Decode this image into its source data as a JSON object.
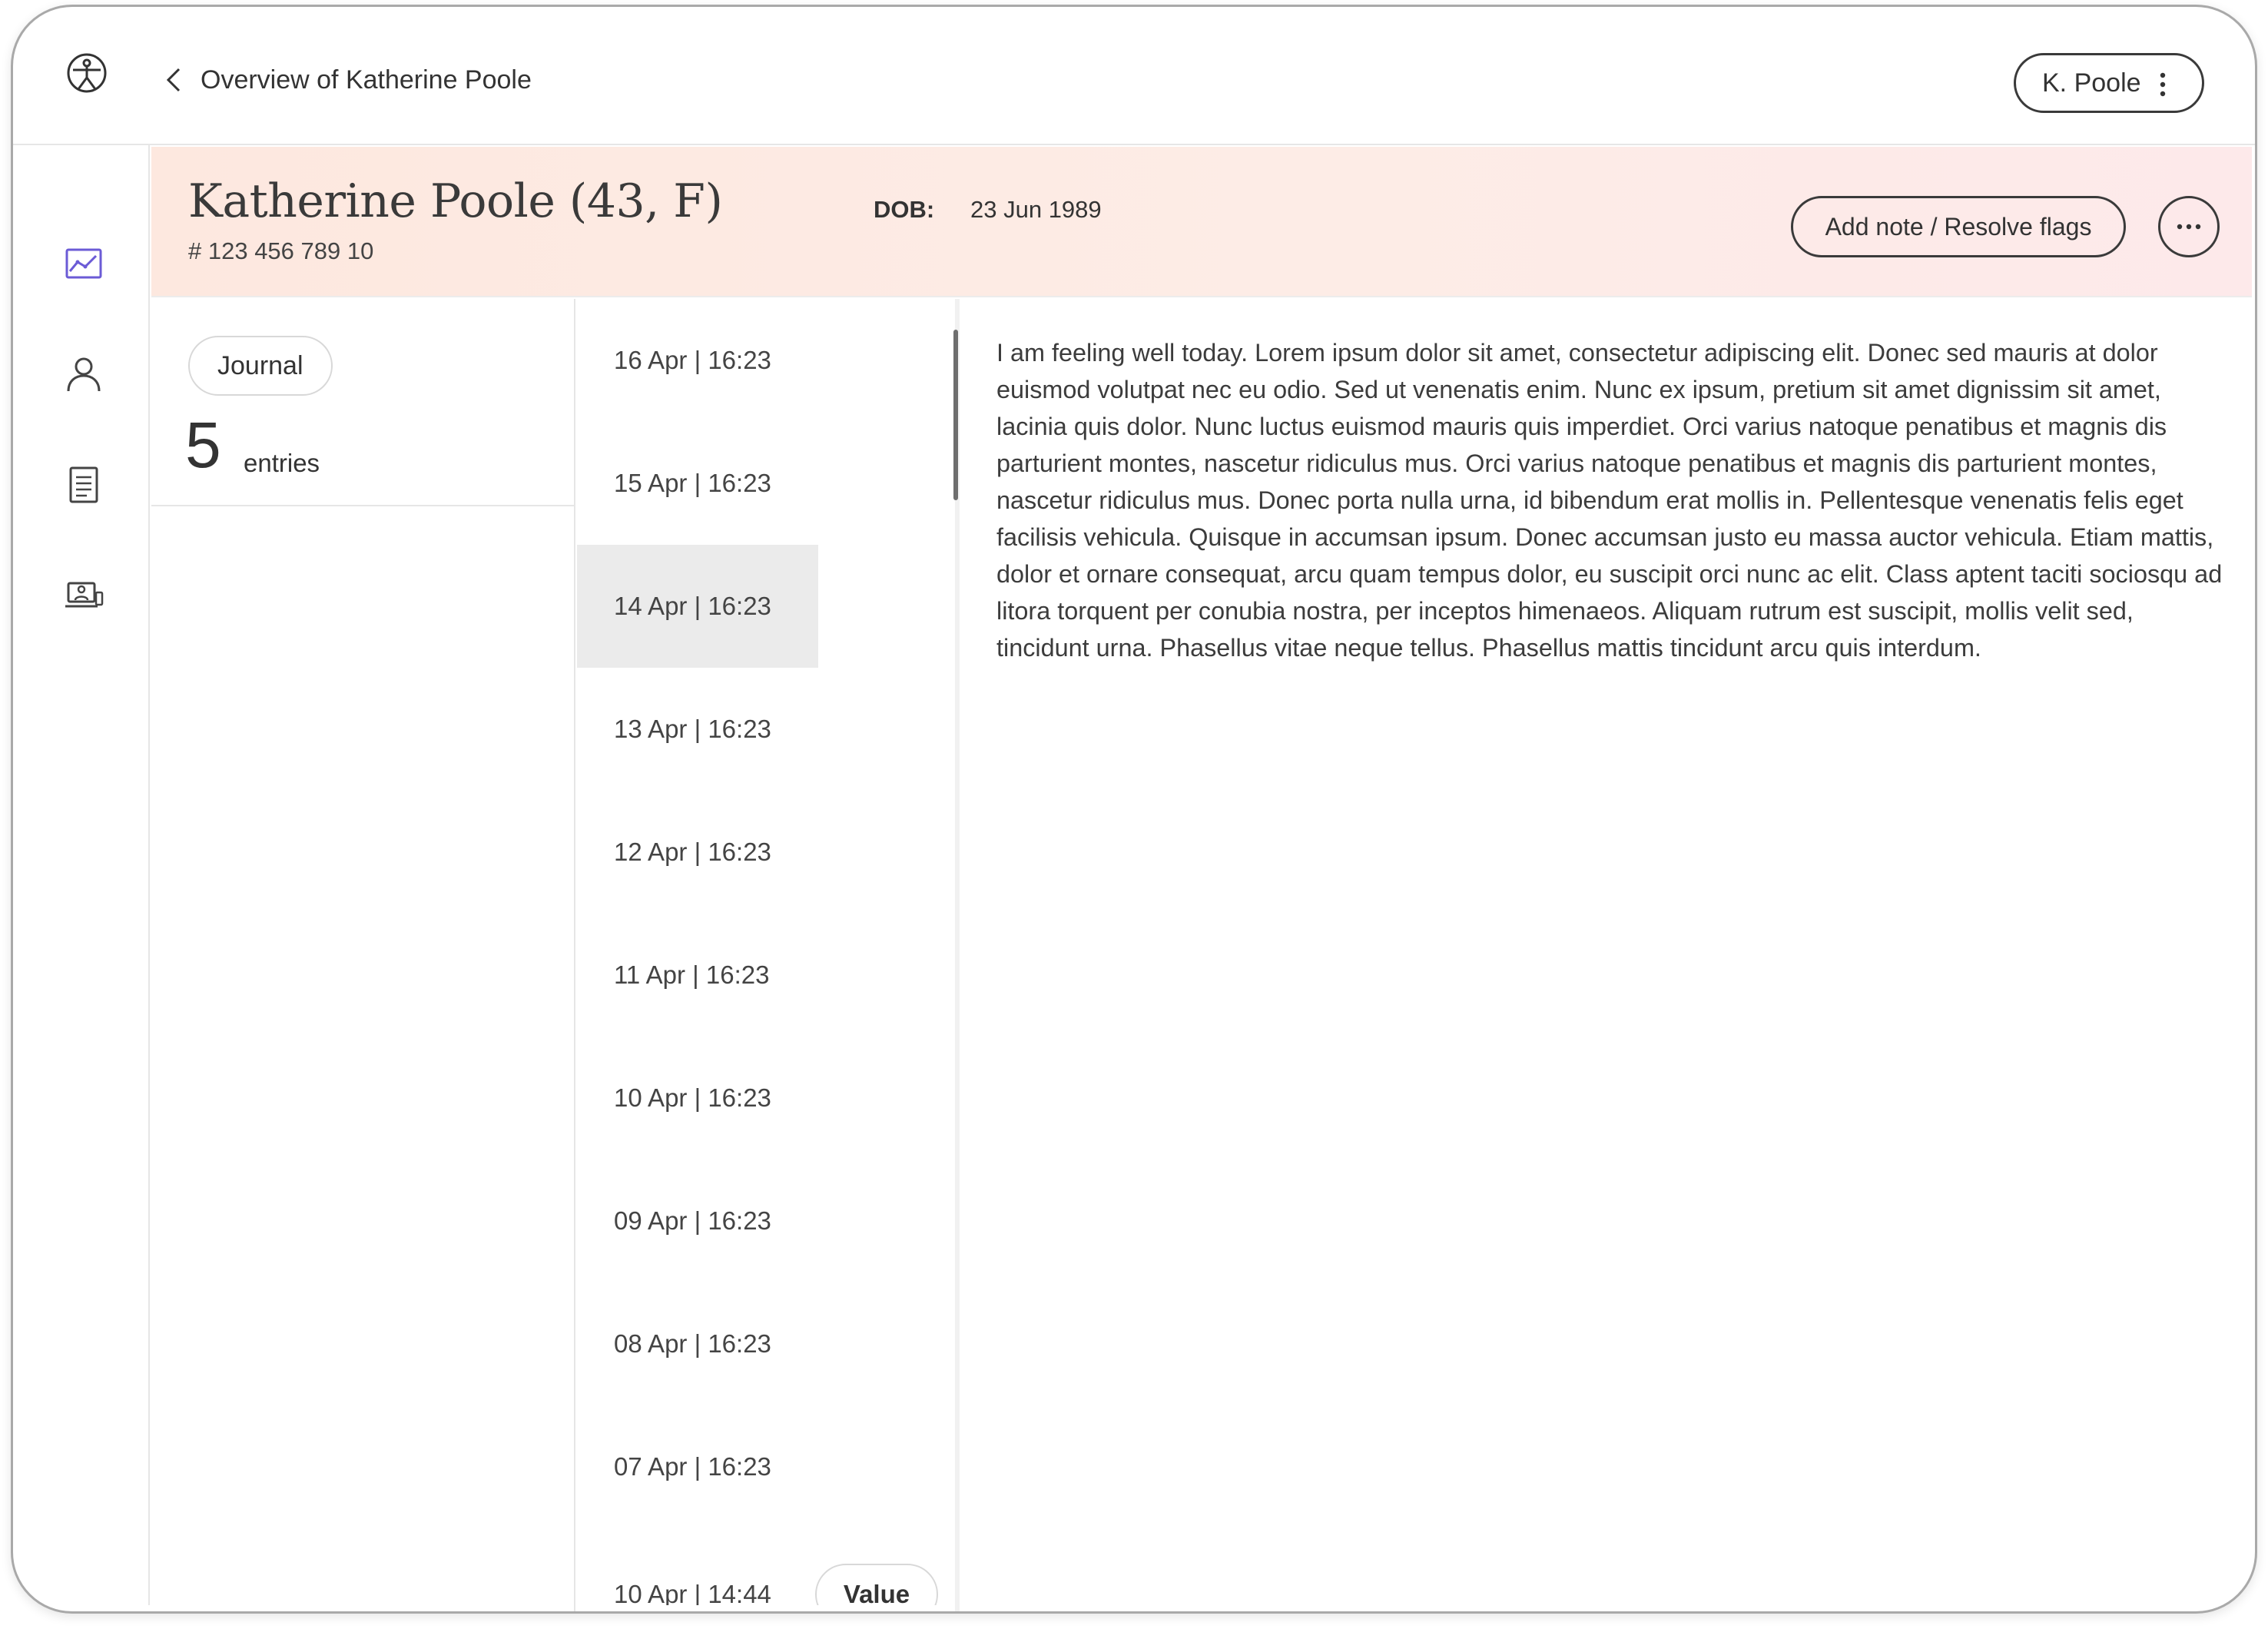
{
  "topbar": {
    "logo_icon": "app-logo-icon",
    "back_icon": "chevron-left-icon",
    "back_label": "Overview of Katherine Poole",
    "user_label": "K. Poole",
    "user_menu_icon": "kebab-vertical-icon"
  },
  "sidebar": {
    "items": [
      {
        "name": "charts",
        "icon": "line-chart-icon",
        "active": true,
        "color": "#6b5bd6"
      },
      {
        "name": "profile",
        "icon": "user-icon",
        "active": false
      },
      {
        "name": "notes",
        "icon": "document-icon",
        "active": false
      },
      {
        "name": "consultation",
        "icon": "video-consult-icon",
        "active": false
      }
    ]
  },
  "patient": {
    "name": "Katherine Poole (43,  F)",
    "id": "# 123 456 789 10",
    "dob_label": "DOB:",
    "dob_value": "23 Jun 1989",
    "add_note_label": "Add note / Resolve flags",
    "more_icon": "more-horizontal-icon"
  },
  "journal": {
    "tag": "Journal",
    "count": "5",
    "count_label": "entries"
  },
  "entries": [
    {
      "label": "16 Apr | 16:23",
      "selected": false
    },
    {
      "label": "15 Apr | 16:23",
      "selected": false
    },
    {
      "label": "14 Apr | 16:23",
      "selected": true
    },
    {
      "label": "13 Apr | 16:23",
      "selected": false
    },
    {
      "label": "12 Apr | 16:23",
      "selected": false
    },
    {
      "label": "11 Apr | 16:23",
      "selected": false
    },
    {
      "label": "10 Apr | 16:23",
      "selected": false
    },
    {
      "label": "09 Apr | 16:23",
      "selected": false
    },
    {
      "label": "08 Apr | 16:23",
      "selected": false
    },
    {
      "label": "07 Apr | 16:23",
      "selected": false
    },
    {
      "label": "10 Apr | 14:44",
      "selected": false
    }
  ],
  "value_button": "Value",
  "entry_text": "I am feeling well today. Lorem ipsum dolor sit amet, consectetur adipiscing elit. Donec sed mauris at dolor euismod volutpat nec eu odio. Sed ut venenatis enim. Nunc ex ipsum, pretium sit amet dignissim sit amet, lacinia quis dolor. Nunc luctus euismod mauris quis imperdiet. Orci varius natoque penatibus et magnis dis parturient montes, nascetur ridiculus mus. Orci varius natoque penatibus et magnis dis parturient montes, nascetur ridiculus mus. Donec porta nulla urna, id bibendum erat mollis in. Pellentesque venenatis felis eget facilisis vehicula. Quisque in accumsan ipsum. Donec accumsan justo eu massa auctor vehicula. Etiam mattis, dolor et ornare consequat, arcu quam tempus dolor, eu suscipit orci nunc ac elit. Class aptent taciti sociosqu ad litora torquent per conubia nostra, per inceptos himenaeos. Aliquam rutrum est suscipit, mollis velit sed, tincidunt urna. Phasellus vitae neque tellus. Phasellus mattis tincidunt arcu quis interdum.",
  "colors": {
    "accent": "#6b5bd6",
    "header_gradient_start": "#fde8df",
    "header_gradient_end": "#fde9ea",
    "selected_row": "#ebebeb"
  }
}
